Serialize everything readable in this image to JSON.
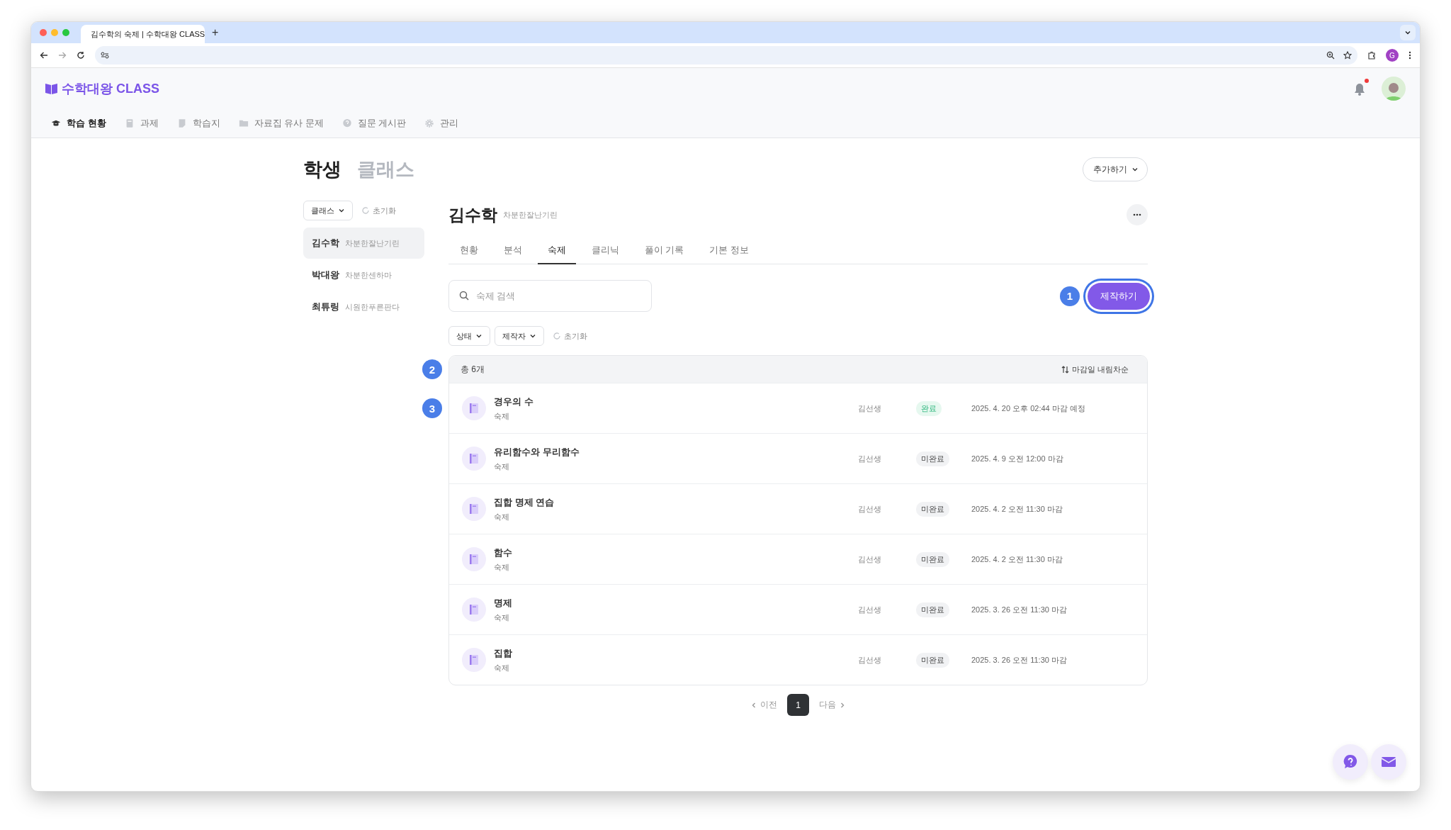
{
  "browser": {
    "tab_title": "김수학의 숙제 | 수학대왕 CLASS",
    "new_tab": "+",
    "profile_initial": "G"
  },
  "app": {
    "logo": "수학대왕 CLASS",
    "notification": true,
    "nav": [
      {
        "label": "학습 현황",
        "selected": true
      },
      {
        "label": "과제",
        "selected": false
      },
      {
        "label": "학습지",
        "selected": false
      },
      {
        "label": "자료집 유사 문제",
        "selected": false
      },
      {
        "label": "질문 게시판",
        "selected": false
      },
      {
        "label": "관리",
        "selected": false
      }
    ]
  },
  "page": {
    "title_tabs": [
      {
        "label": "학생",
        "selected": true
      },
      {
        "label": "클래스",
        "selected": false
      }
    ],
    "add_button": "추가하기"
  },
  "sidebar": {
    "class_filter": "클래스",
    "reset": "초기화",
    "students": [
      {
        "name": "김수학",
        "nickname": "차분한잘난기린",
        "selected": true
      },
      {
        "name": "박대왕",
        "nickname": "차분한센하마",
        "selected": false
      },
      {
        "name": "최튜링",
        "nickname": "시원한푸른판다",
        "selected": false
      }
    ]
  },
  "student": {
    "name": "김수학",
    "nickname": "차분한잘난기린"
  },
  "tabs": [
    {
      "label": "현황",
      "selected": false
    },
    {
      "label": "분석",
      "selected": false
    },
    {
      "label": "숙제",
      "selected": true
    },
    {
      "label": "클리닉",
      "selected": false
    },
    {
      "label": "풀이 기록",
      "selected": false
    },
    {
      "label": "기본 정보",
      "selected": false
    }
  ],
  "search": {
    "placeholder": "숙제 검색"
  },
  "create_button": {
    "label": "제작하기",
    "highlighted": true,
    "callout": "1"
  },
  "filters": [
    "상태",
    "제작자"
  ],
  "filter_reset": "초기화",
  "table": {
    "total": "총 6개",
    "sort": "마감일 내림차순",
    "callout": "2",
    "rows": [
      {
        "title": "경우의 수",
        "type": "숙제",
        "author": "김선생",
        "status": "완료",
        "kind": "complete",
        "due": "2025. 4. 20 오후 02:44 마감 예정",
        "callout": "3"
      },
      {
        "title": "유리함수와 무리함수",
        "type": "숙제",
        "author": "김선생",
        "status": "미완료",
        "kind": "incomplete",
        "due": "2025. 4. 9 오전 12:00 마감"
      },
      {
        "title": "집합 명제 연습",
        "type": "숙제",
        "author": "김선생",
        "status": "미완료",
        "kind": "incomplete",
        "due": "2025. 4. 2 오전 11:30 마감"
      },
      {
        "title": "함수",
        "type": "숙제",
        "author": "김선생",
        "status": "미완료",
        "kind": "incomplete",
        "due": "2025. 4. 2 오전 11:30 마감"
      },
      {
        "title": "명제",
        "type": "숙제",
        "author": "김선생",
        "status": "미완료",
        "kind": "incomplete",
        "due": "2025. 3. 26 오전 11:30 마감"
      },
      {
        "title": "집합",
        "type": "숙제",
        "author": "김선생",
        "status": "미완료",
        "kind": "incomplete",
        "due": "2025. 3. 26 오전 11:30 마감"
      }
    ]
  },
  "pagination": {
    "prev": "이전",
    "pages": [
      {
        "label": "1",
        "selected": true
      }
    ],
    "next": "다음"
  }
}
